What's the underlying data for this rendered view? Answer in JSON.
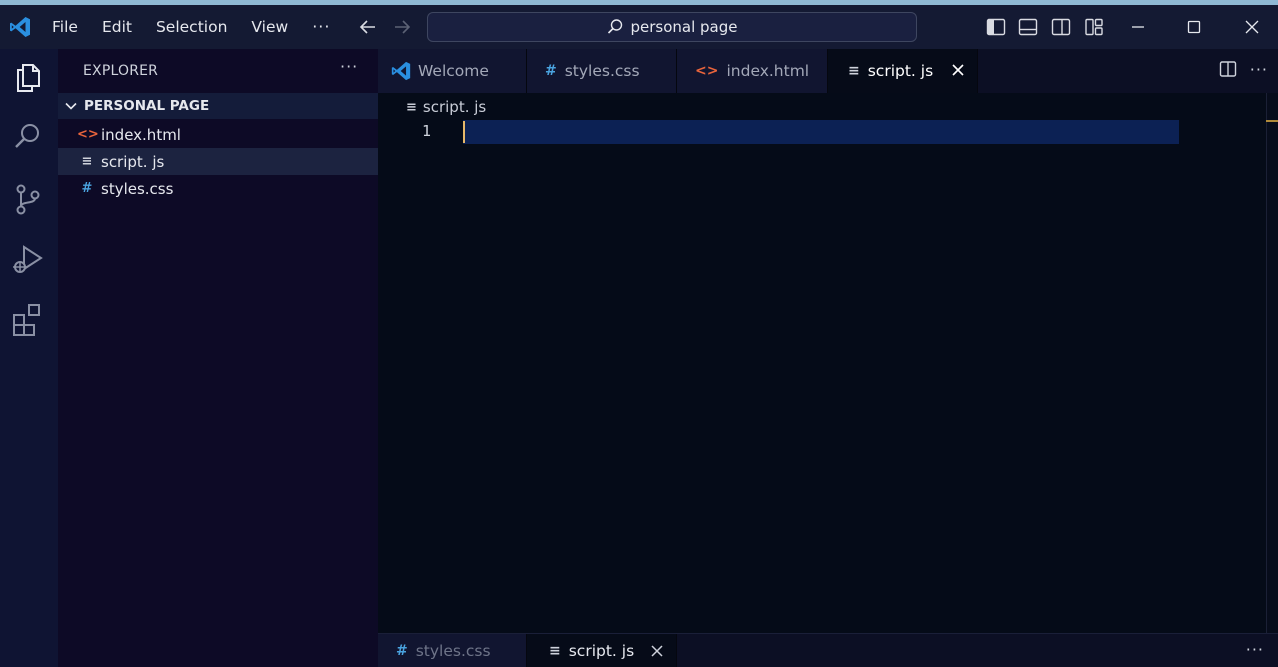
{
  "menu": {
    "items": [
      "File",
      "Edit",
      "Selection",
      "View"
    ],
    "more": "···"
  },
  "search": {
    "text": "personal page"
  },
  "sidebar": {
    "header": "EXPLORER",
    "more": "···",
    "folder": "PERSONAL PAGE",
    "files": [
      {
        "name": "index.html",
        "icon": "<>",
        "icon_name": "html-file-icon",
        "color": "#e8643c"
      },
      {
        "name": "script. js",
        "icon": "≡",
        "icon_name": "text-file-icon",
        "color": "#cfd3dc"
      },
      {
        "name": "styles.css",
        "icon": "#",
        "icon_name": "css-file-icon",
        "color": "#4aa3df"
      }
    ]
  },
  "tabs": [
    {
      "label": "Welcome",
      "icon": "vscode-logo-icon"
    },
    {
      "label": "styles.css",
      "icon": "#",
      "color": "#4aa3df"
    },
    {
      "label": "index.html",
      "icon": "<>",
      "color": "#e8643c"
    },
    {
      "label": "script. js",
      "icon": "≡",
      "color": "#cfd3dc",
      "active": true
    }
  ],
  "editor": {
    "breadcrumb": "script. js",
    "line_number": "1"
  },
  "bottom_tabs": [
    {
      "label": "styles.css",
      "icon": "#",
      "color": "#4aa3df"
    },
    {
      "label": "script. js",
      "icon": "≡",
      "color": "#cfd3dc",
      "active": true
    }
  ],
  "colors": {
    "accent": "#1f8ad2",
    "html_icon": "#e8643c",
    "css_icon": "#4aa3df",
    "cursor": "#e6b86a"
  }
}
